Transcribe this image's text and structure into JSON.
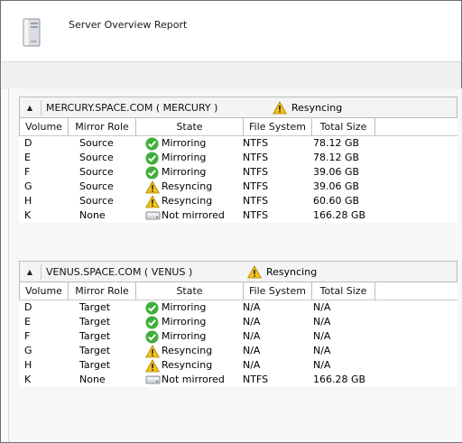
{
  "report": {
    "title": "Server Overview Report"
  },
  "colors": {
    "ok": "#3fae3a",
    "warn": "#f2c21a",
    "border": "#bdbdbd"
  },
  "columns": [
    "Volume",
    "Mirror Role",
    "State",
    "File System",
    "Total Size"
  ],
  "servers": [
    {
      "name": "MERCURY.SPACE.COM  ( MERCURY )",
      "state": "Resyncing",
      "state_icon": "warning-icon",
      "rows": [
        {
          "volume": "D",
          "role": "Source",
          "state": "Mirroring",
          "icon": "check-icon",
          "fs": "NTFS",
          "size": "78.12 GB"
        },
        {
          "volume": "E",
          "role": "Source",
          "state": "Mirroring",
          "icon": "check-icon",
          "fs": "NTFS",
          "size": "78.12 GB"
        },
        {
          "volume": "F",
          "role": "Source",
          "state": "Mirroring",
          "icon": "check-icon",
          "fs": "NTFS",
          "size": "39.06 GB"
        },
        {
          "volume": "G",
          "role": "Source",
          "state": "Resyncing",
          "icon": "warning-icon",
          "fs": "NTFS",
          "size": "39.06 GB"
        },
        {
          "volume": "H",
          "role": "Source",
          "state": "Resyncing",
          "icon": "warning-icon",
          "fs": "NTFS",
          "size": "60.60 GB"
        },
        {
          "volume": "K",
          "role": "None",
          "state": "Not mirrored",
          "icon": "drive-icon",
          "fs": "NTFS",
          "size": "166.28 GB"
        }
      ]
    },
    {
      "name": "VENUS.SPACE.COM  ( VENUS )",
      "state": "Resyncing",
      "state_icon": "warning-icon",
      "rows": [
        {
          "volume": "D",
          "role": "Target",
          "state": "Mirroring",
          "icon": "check-icon",
          "fs": "N/A",
          "size": "N/A"
        },
        {
          "volume": "E",
          "role": "Target",
          "state": "Mirroring",
          "icon": "check-icon",
          "fs": "N/A",
          "size": "N/A"
        },
        {
          "volume": "F",
          "role": "Target",
          "state": "Mirroring",
          "icon": "check-icon",
          "fs": "N/A",
          "size": "N/A"
        },
        {
          "volume": "G",
          "role": "Target",
          "state": "Resyncing",
          "icon": "warning-icon",
          "fs": "N/A",
          "size": "N/A"
        },
        {
          "volume": "H",
          "role": "Target",
          "state": "Resyncing",
          "icon": "warning-icon",
          "fs": "N/A",
          "size": "N/A"
        },
        {
          "volume": "K",
          "role": "None",
          "state": "Not mirrored",
          "icon": "drive-icon",
          "fs": "NTFS",
          "size": "166.28 GB"
        }
      ]
    }
  ]
}
